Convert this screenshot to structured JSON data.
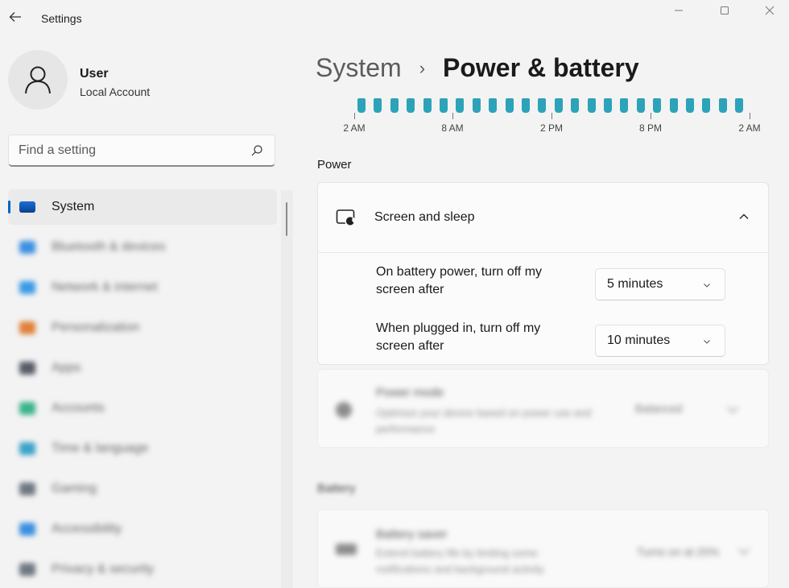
{
  "window": {
    "title": "Settings"
  },
  "user": {
    "name": "User",
    "account_type": "Local Account"
  },
  "search": {
    "placeholder": "Find a setting"
  },
  "sidebar": {
    "items": [
      {
        "label": "System",
        "active": true,
        "icon": "system-icon",
        "color": "#0067c0"
      },
      {
        "label": "Bluetooth & devices",
        "icon": "bluetooth-icon",
        "color": "#3b8fe0"
      },
      {
        "label": "Network & internet",
        "icon": "network-icon",
        "color": "#3a9ae6"
      },
      {
        "label": "Personalization",
        "icon": "brush-icon",
        "color": "#e0803a"
      },
      {
        "label": "Apps",
        "icon": "apps-icon",
        "color": "#555c66"
      },
      {
        "label": "Accounts",
        "icon": "accounts-icon",
        "color": "#3bb38a"
      },
      {
        "label": "Time & language",
        "icon": "time-language-icon",
        "color": "#3aa3c9"
      },
      {
        "label": "Gaming",
        "icon": "gaming-icon",
        "color": "#6e7780"
      },
      {
        "label": "Accessibility",
        "icon": "accessibility-icon",
        "color": "#3a8ee0"
      },
      {
        "label": "Privacy & security",
        "icon": "shield-icon",
        "color": "#6e7780"
      }
    ]
  },
  "breadcrumb": {
    "parent": "System",
    "current": "Power & battery"
  },
  "timeline": {
    "labels": [
      "2 AM",
      "8 AM",
      "2 PM",
      "8 PM",
      "2 AM"
    ],
    "bar_color": "#2ca3b8"
  },
  "power": {
    "section_label": "Power",
    "screen_sleep": {
      "title": "Screen and sleep",
      "battery_label": "On battery power, turn off my screen after",
      "battery_value": "5 minutes",
      "plugged_label": "When plugged in, turn off my screen after",
      "plugged_value": "10 minutes"
    },
    "power_mode": {
      "title": "Power mode",
      "description": "Optimize your device based on power use and performance",
      "value": "Balanced"
    }
  },
  "battery": {
    "section_label": "Battery",
    "saver": {
      "title": "Battery saver",
      "description": "Extend battery life by limiting some notifications and background activity",
      "value": "Turns on at 20%"
    }
  },
  "colors": {
    "accent": "#0067c0",
    "background": "#f3f3f3",
    "card": "#fbfbfb"
  }
}
